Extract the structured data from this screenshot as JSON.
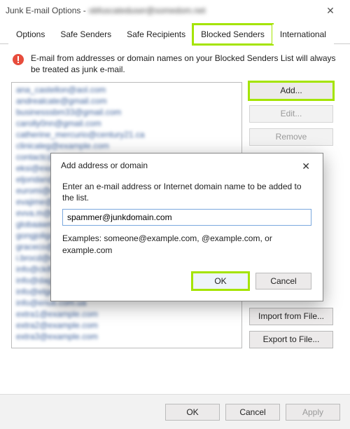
{
  "window": {
    "title_prefix": "Junk E-mail Options -",
    "title_email": "obfuscateduser@somedom.net"
  },
  "tabs": {
    "items": [
      {
        "label": "Options"
      },
      {
        "label": "Safe Senders"
      },
      {
        "label": "Safe Recipients"
      },
      {
        "label": "Blocked Senders"
      },
      {
        "label": "International"
      }
    ],
    "active_index": 3
  },
  "blocked": {
    "description": "E-mail from addresses or domain names on your Blocked Senders List will always be treated as junk e-mail.",
    "list": [
      "ana_castellon@aol.com",
      "andrealcate@gmail.com",
      "businesssbm33@gmail.com",
      "carolly0nn@gmail.com",
      "catherine_mercurio@century21.ca",
      "clinicaleg@example.com",
      "contactc@example.com",
      "eksi@example.com",
      "eljoridan@example.com",
      "euromi@example.com",
      "evajime@example.com",
      "evva.m@example.com",
      "globaawm@example.com",
      "gongjolig@example.com",
      "graceco@example.com",
      "i.brocd@example.com",
      "info@ckifs.cz",
      "info@dagema.com",
      "info@elgas.com",
      "info@enuti.com.ua",
      "extra1@example.com",
      "extra2@example.com",
      "extra3@example.com"
    ],
    "buttons": {
      "add": "Add...",
      "edit": "Edit...",
      "remove": "Remove",
      "import": "Import from File...",
      "export": "Export to File..."
    }
  },
  "footer": {
    "ok": "OK",
    "cancel": "Cancel",
    "apply": "Apply"
  },
  "modal": {
    "title": "Add address or domain",
    "prompt": "Enter an e-mail address or Internet domain name to be added to the list.",
    "input_value": "spammer@junkdomain.com",
    "examples": "Examples: someone@example.com, @example.com, or example.com",
    "ok": "OK",
    "cancel": "Cancel"
  }
}
